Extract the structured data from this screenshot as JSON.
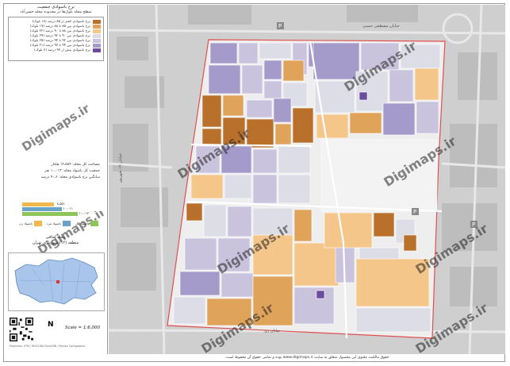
{
  "legend": {
    "title": "نرخ باسوادی جمعیت",
    "subtitle": "سطح محله بلوک‌ها در محدوده محله حسن‌آباد",
    "classes": [
      {
        "label": "نرخ باسوادی کمتر از ۸۵ درصد (۱۸ بلوک)",
        "color": "#b8702a"
      },
      {
        "label": "نرخ باسوادی بین ۸۵ تا ۸۸ درصد (۱۹ بلوک)",
        "color": "#e0a35a"
      },
      {
        "label": "نرخ باسوادی بین ۸۸ تا ۹۰ درصد (۲۲ بلوک)",
        "color": "#f5c68a"
      },
      {
        "label": "نرخ باسوادی بین ۹۰ تا ۹۲ درصد (۲۹ بلوک)",
        "color": "#dddde8"
      },
      {
        "label": "نرخ باسوادی بین ۹۲ تا ۹۴ درصد (۲۵ بلوک)",
        "color": "#c9c3de"
      },
      {
        "label": "نرخ باسوادی بین ۹۴ تا ۹۷ درصد (۲۱ بلوک)",
        "color": "#a59bcb"
      },
      {
        "label": "نرخ باسوادی بیش از ۹۷ درصد (۷ بلوک)",
        "color": "#6a4c9c"
      }
    ]
  },
  "stats": {
    "area": "مساحت کل محله: ۱۴،۵۸۴ هکتار",
    "population": "جمعیت کل باسواد محله: ۱۰،۰۱۳ نفر",
    "literate": "میانگین نرخ باسوادی محله: ۹۰،۶ درصد",
    "bar_values": [
      "۸،۵۵۱",
      "۱۰،۰۱۱",
      "۱۰،۰۱۳"
    ],
    "bar_colors": [
      "#f2b84b",
      "#6aa3c9",
      "#8fc45a"
    ],
    "icons": [
      "باسواد کل",
      "باسواد مرد",
      "باسواد زن"
    ]
  },
  "inset": {
    "title": "محله لحافی",
    "subtitle": "منطقه (۱۲) شهرداری تهران"
  },
  "scale": "Scale = 1:6,000",
  "north": "N",
  "credit": "Projection: UTM / WGS1984 Zone39N / Persian Cartographic",
  "watermark": "Digimaps.ir",
  "footer": "حقوق مالکیت معنوی این محصول متعلق به سایت www.digimaps.ir بوده و تمامی حقوق آن محفوظ است.",
  "street_labels": [
    "خیابان مصطفی خمینی",
    "خیابان ری",
    "خیابان ۱۷ شهریور"
  ]
}
